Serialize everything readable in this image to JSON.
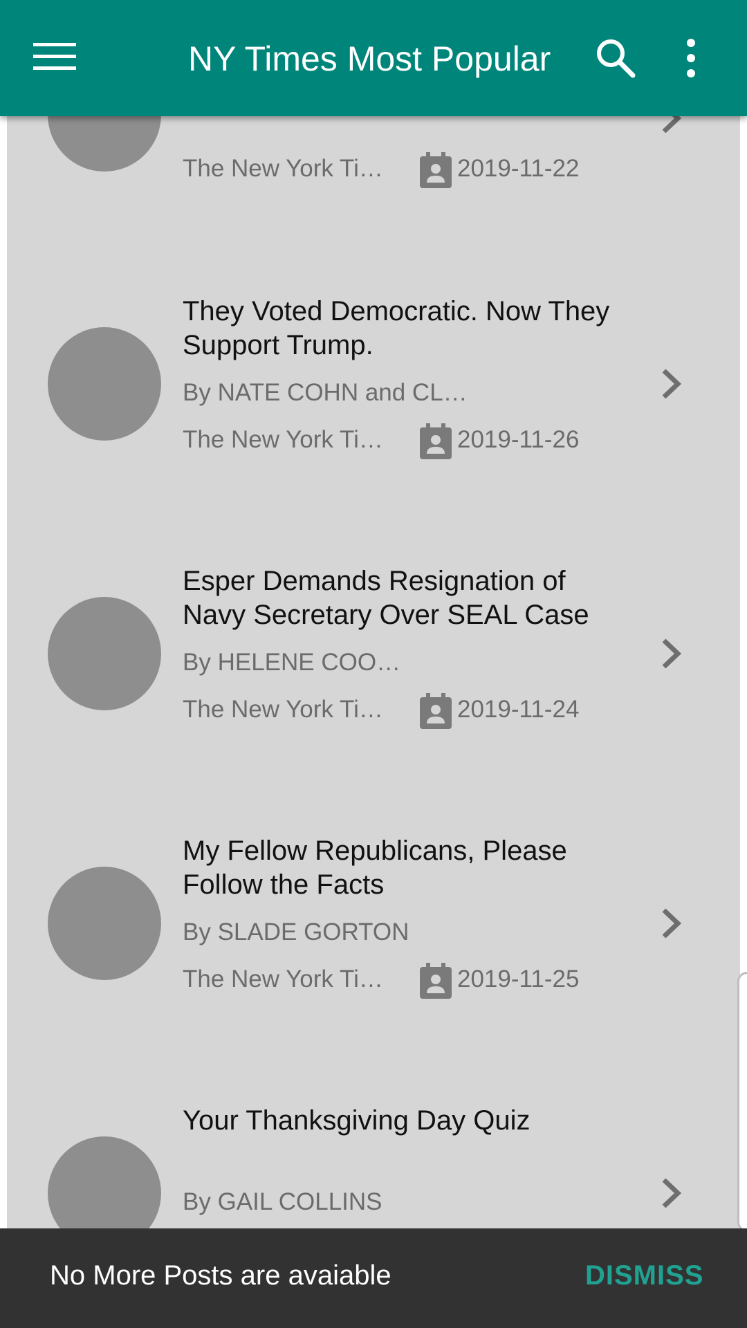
{
  "appbar": {
    "title": "NY Times Most Popular",
    "menu_icon": "hamburger-menu-icon",
    "search_icon": "search-icon",
    "more_icon": "more-vert-icon",
    "color": "#00857a"
  },
  "articles": [
    {
      "title": "",
      "byline": "",
      "source": "The New York Ti…",
      "date": "2019-11-22"
    },
    {
      "title": "They Voted Democratic. Now They Support Trump.",
      "byline": "By NATE COHN and CL…",
      "source": "The New York Ti…",
      "date": "2019-11-26"
    },
    {
      "title": "Esper Demands Resignation of Navy Secretary Over SEAL Case",
      "byline": "By HELENE COO…",
      "source": "The New York Ti…",
      "date": "2019-11-24"
    },
    {
      "title": "My Fellow Republicans, Please Follow the Facts",
      "byline": "By SLADE GORTON",
      "source": "The New York Ti…",
      "date": "2019-11-25"
    },
    {
      "title": "Your Thanksgiving Day Quiz",
      "byline": "By GAIL COLLINS",
      "source": "",
      "date": ""
    }
  ],
  "snackbar": {
    "message": "No More Posts are avaiable",
    "action": "DISMISS",
    "action_color": "#1fa291"
  }
}
